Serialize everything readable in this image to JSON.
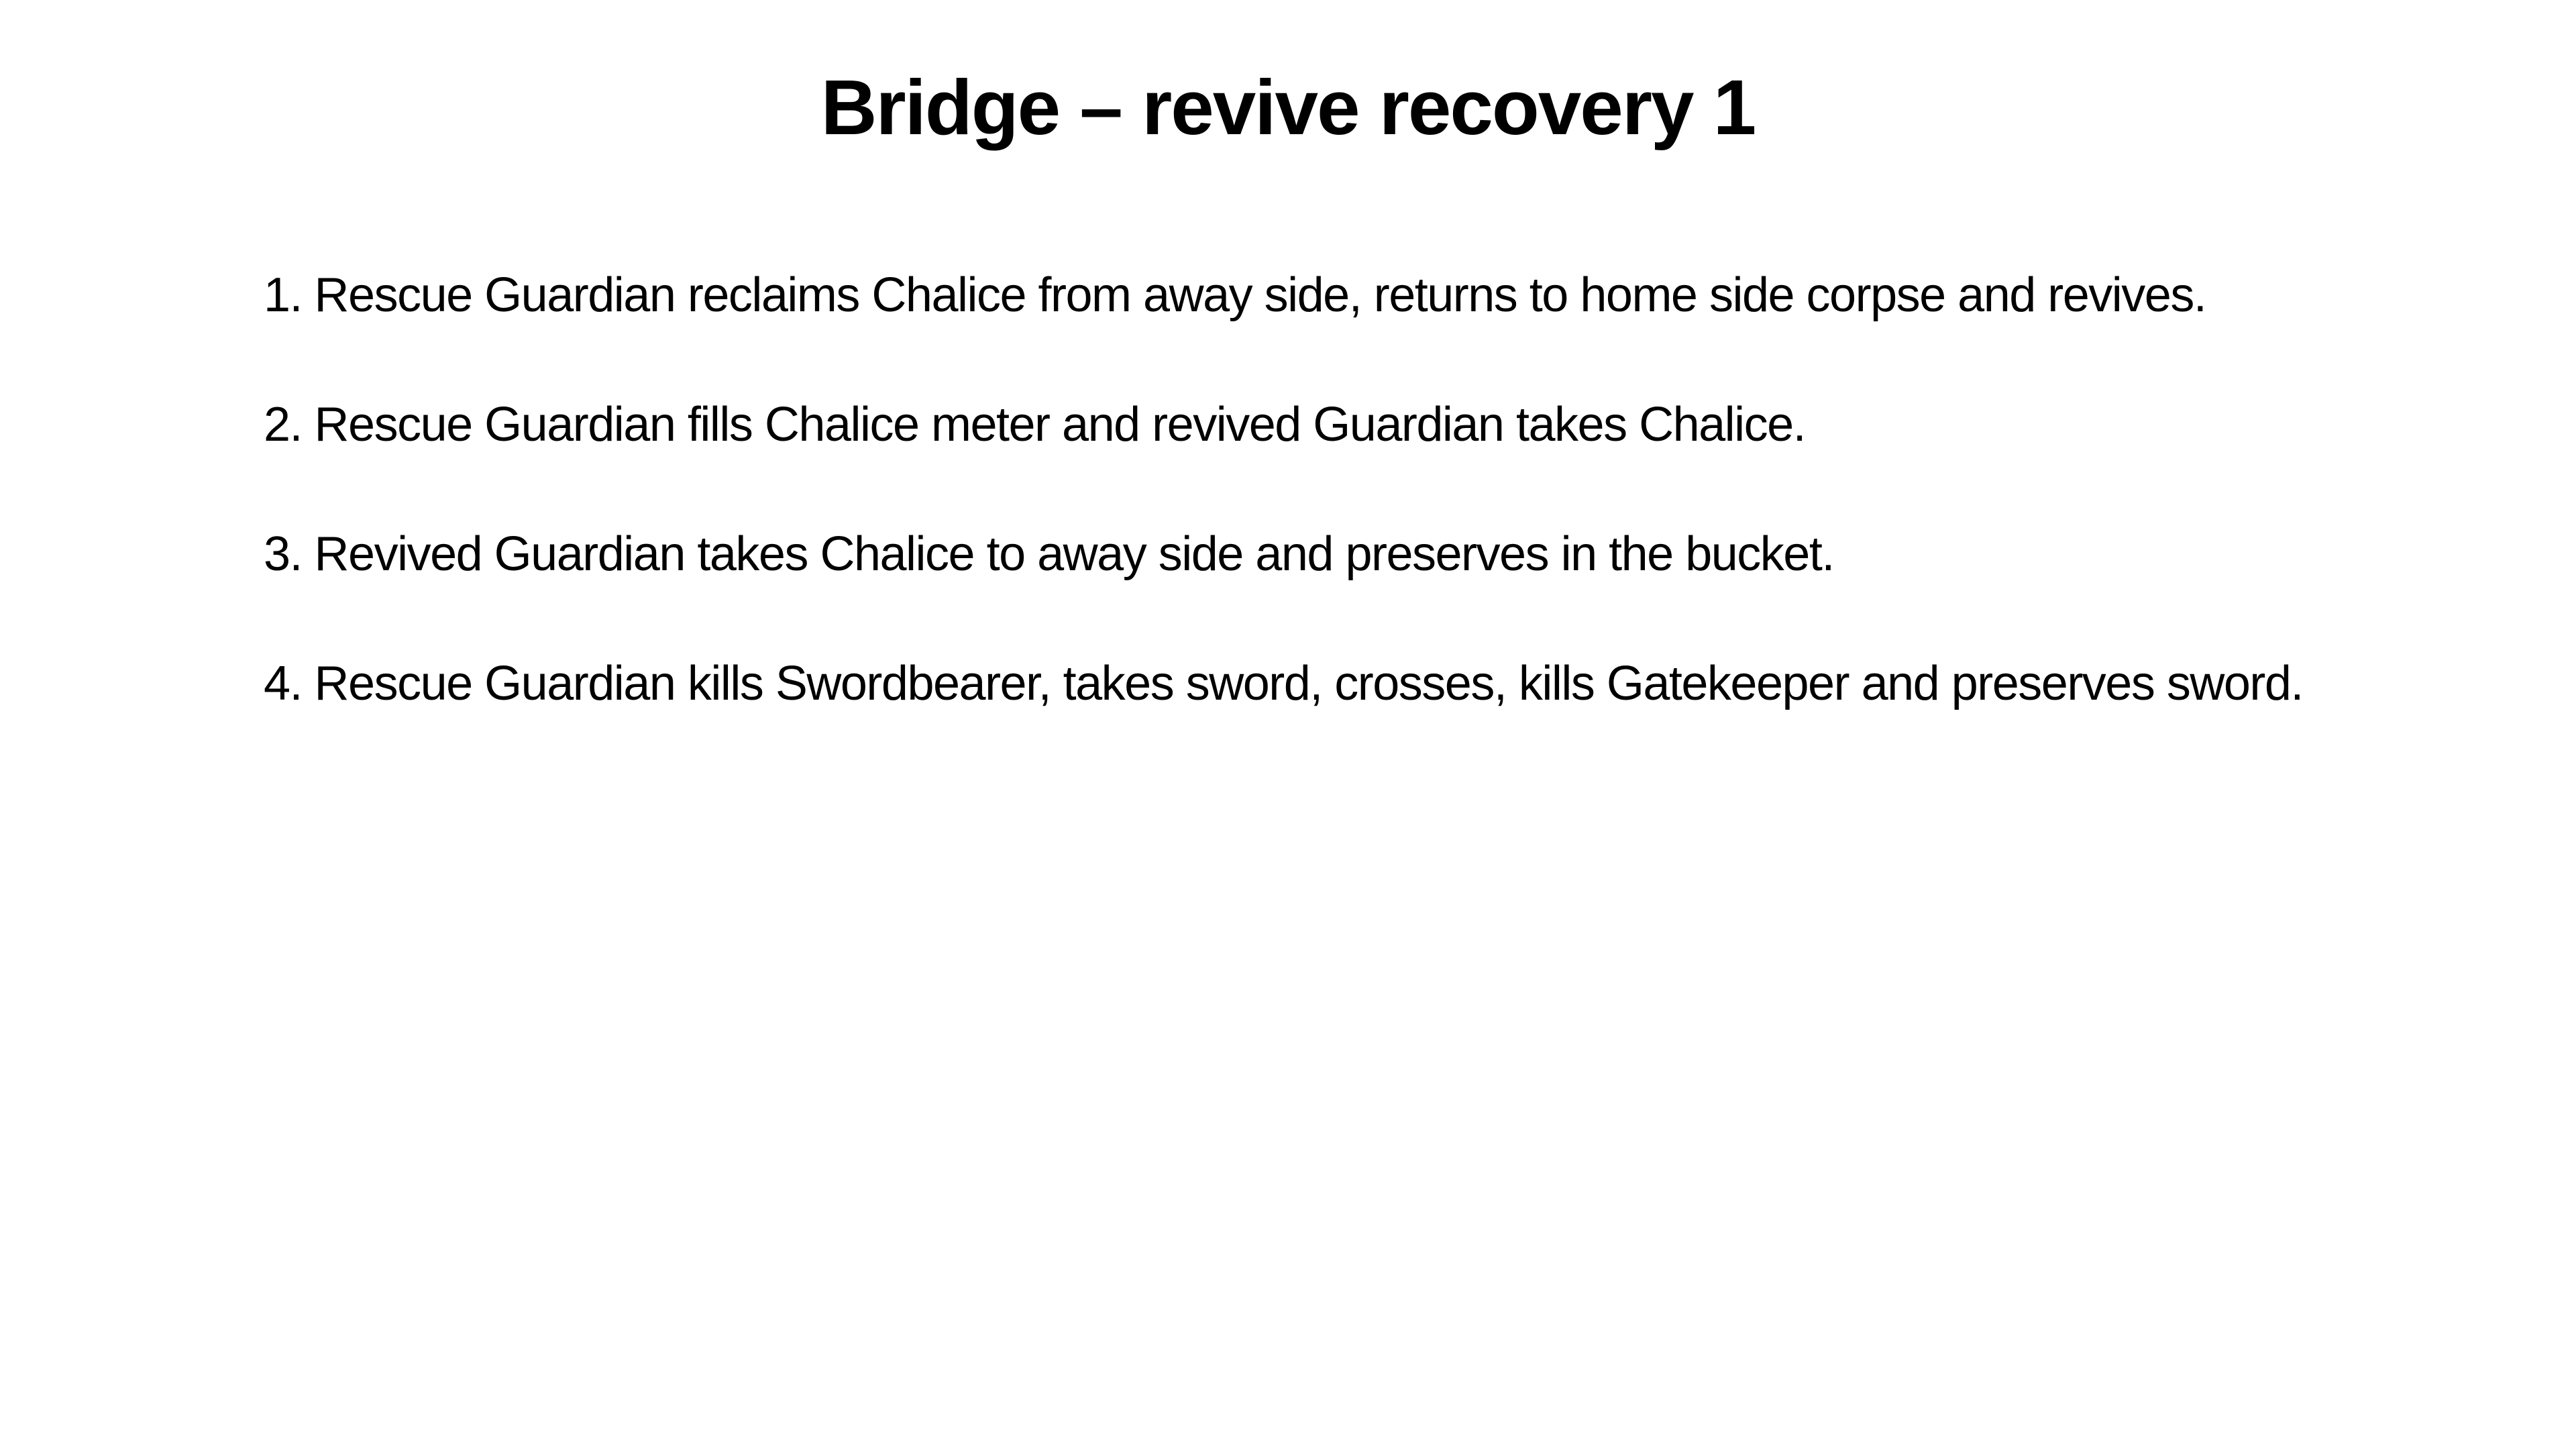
{
  "slide": {
    "title": "Bridge – revive recovery 1",
    "steps": [
      "1. Rescue Guardian reclaims Chalice from away side, returns to home side corpse and revives.",
      "2. Rescue Guardian fills Chalice meter and revived Guardian takes Chalice.",
      "3. Revived Guardian takes Chalice to away side and preserves in the bucket.",
      "4. Rescue Guardian kills Swordbearer, takes sword, crosses, kills Gatekeeper and preserves sword."
    ]
  }
}
